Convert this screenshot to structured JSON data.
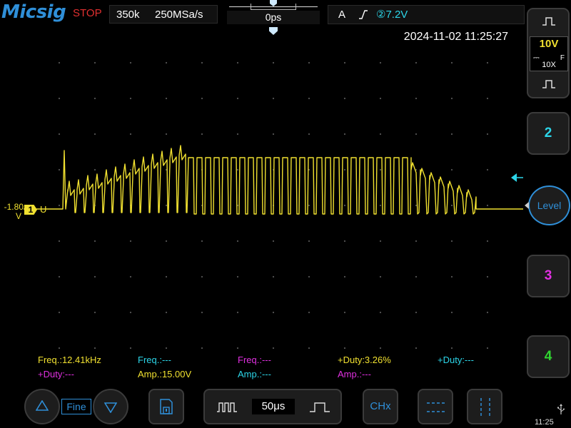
{
  "header": {
    "brand": "Micsig",
    "run_state": "STOP",
    "memory_depth": "350k",
    "sample_rate": "250MSa/s",
    "time_offset": "0ps",
    "trigger_mode": "A",
    "trigger_source_level": "②7.2V"
  },
  "screen": {
    "timestamp": "2024-11-02 11:25:27",
    "ch1_offset_value": "-1.80",
    "ch1_offset_unit": "V",
    "ch1_badge": "1",
    "ch1_badge_unit": "U"
  },
  "measurements": [
    {
      "text": "Freq.:12.41kHz",
      "color": "#f0e030"
    },
    {
      "text": "Freq.:---",
      "color": "#2cd5e8"
    },
    {
      "text": "Freq.:---",
      "color": "#e030e0"
    },
    {
      "text": "+Duty:3.26%",
      "color": "#f0e030"
    },
    {
      "text": "+Duty:---",
      "color": "#2cd5e8"
    },
    {
      "text": "+Duty:---",
      "color": "#e030e0"
    },
    {
      "text": "Amp.:15.00V",
      "color": "#f0e030"
    },
    {
      "text": "Amp.:---",
      "color": "#2cd5e8"
    },
    {
      "text": "Amp.:---",
      "color": "#e030e0"
    }
  ],
  "right_panel": {
    "ch1_vdiv": "10V",
    "ch1_coupling": "⎓",
    "ch1_bw": "F",
    "ch1_probe": "10X",
    "ch2_label": "2",
    "ch3_label": "3",
    "ch4_label": "4",
    "level_label": "Level",
    "clock": "11:25",
    "colors": {
      "ch1": "#f0e030",
      "ch2": "#2cd5e8",
      "ch3": "#e030e0",
      "ch4": "#30d530",
      "accent": "#2f8fd8"
    }
  },
  "bottom": {
    "fine_label": "Fine",
    "timebase": "50μs",
    "chx_label": "CHx"
  },
  "icons": [
    "up-arrow-icon",
    "down-arrow-icon",
    "save-icon",
    "pulse-wide-icon",
    "pulse-narrow-icon",
    "cursor-horizontal-icon",
    "cursor-vertical-icon",
    "usb-icon",
    "rising-edge-icon"
  ]
}
